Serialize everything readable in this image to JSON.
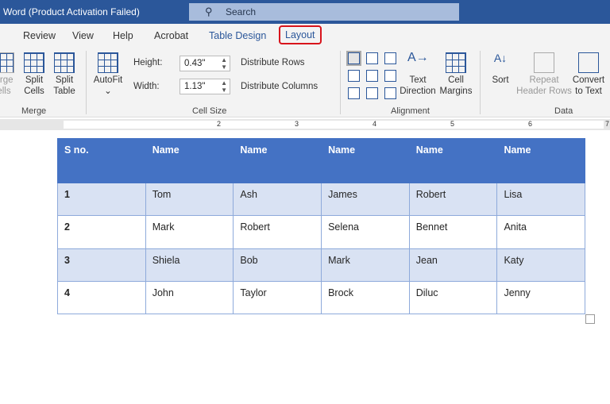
{
  "titlebar": {
    "title": "Word (Product Activation Failed)",
    "search_placeholder": "Search"
  },
  "tabs": [
    "Review",
    "View",
    "Help",
    "Acrobat",
    "Table Design",
    "Layout"
  ],
  "ribbon": {
    "merge": {
      "merge_cells": "erge\nells",
      "split_cells": "Split\nCells",
      "split_table": "Split\nTable",
      "group": "Merge"
    },
    "cell_size": {
      "autofit": "AutoFit",
      "height_label": "Height:",
      "height_value": "0.43\"",
      "width_label": "Width:",
      "width_value": "1.13\"",
      "distribute_rows": "Distribute Rows",
      "distribute_columns": "Distribute Columns",
      "group": "Cell Size"
    },
    "alignment": {
      "text_direction": "Text\nDirection",
      "cell_margins": "Cell\nMargins",
      "group": "Alignment"
    },
    "data": {
      "sort": "Sort",
      "repeat_header_rows": "Repeat\nHeader Rows",
      "convert_to_text": "Convert\nto Text",
      "group": "Data"
    }
  },
  "ruler": [
    "2",
    "3",
    "4",
    "5",
    "6",
    "7"
  ],
  "table": {
    "headers": [
      "S no.",
      "Name",
      "Name",
      "Name",
      "Name",
      "Name"
    ],
    "rows": [
      [
        "1",
        "Tom",
        "Ash",
        "James",
        "Robert",
        "Lisa"
      ],
      [
        "2",
        "Mark",
        "Robert",
        "Selena",
        "Bennet",
        "Anita"
      ],
      [
        "3",
        "Shiela",
        "Bob",
        "Mark",
        "Jean",
        "Katy"
      ],
      [
        "4",
        "John",
        "Taylor",
        "Brock",
        "Diluc",
        "Jenny"
      ]
    ]
  }
}
